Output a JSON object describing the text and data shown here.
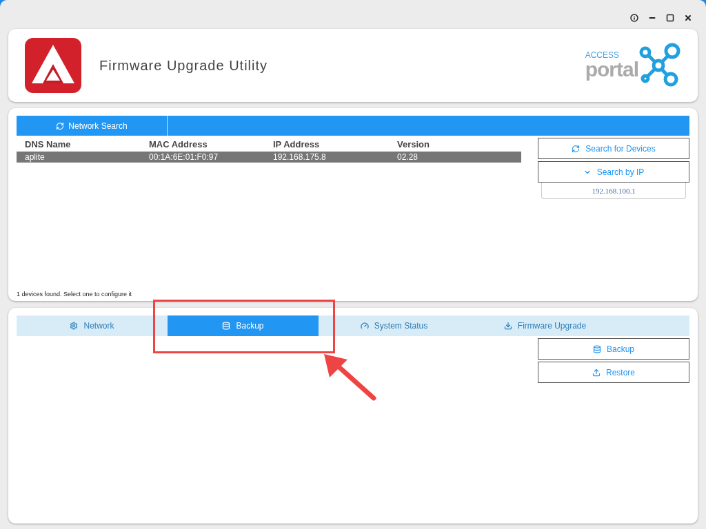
{
  "app": {
    "title": "Firmware Upgrade Utility",
    "brand_small": "ACCESS",
    "brand_large": "portal"
  },
  "search_panel": {
    "tab": "Network Search",
    "columns": [
      "DNS Name",
      "MAC Address",
      "IP Address",
      "Version"
    ],
    "rows": [
      {
        "cells": [
          "aplite",
          "00:1A:6E:01:F0:97",
          "192.168.175.8",
          "02.28"
        ],
        "selected": true
      }
    ],
    "status": "1 devices found. Select one to configure it",
    "buttons": [
      {
        "label": "Search for Devices",
        "kind": "refresh"
      },
      {
        "label": "Search by IP",
        "kind": "chevron"
      }
    ],
    "ip_field": {
      "value": "192.168.100.1"
    }
  },
  "config_panel": {
    "tabs": [
      {
        "label": "Network",
        "kind": "gear",
        "selected": false
      },
      {
        "label": "Backup",
        "kind": "database",
        "selected": true
      },
      {
        "label": "System Status",
        "kind": "gauge",
        "selected": false
      },
      {
        "label": "Firmware Upgrade",
        "kind": "download",
        "selected": false
      }
    ],
    "buttons": [
      {
        "label": "Backup",
        "kind": "database"
      },
      {
        "label": "Restore",
        "kind": "upload"
      }
    ]
  }
}
